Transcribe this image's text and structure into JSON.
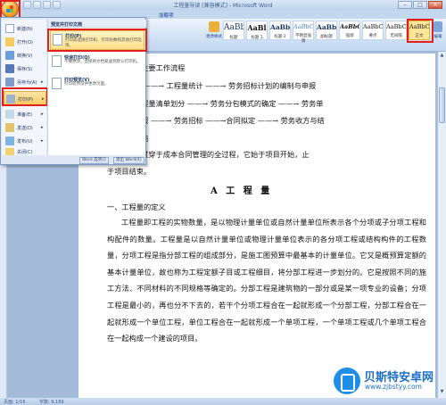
{
  "window": {
    "title": "工程量导读 [兼容模式] - Microsoft Word",
    "ribbon_context": "加载项"
  },
  "ribbon": {
    "styles": [
      {
        "sample": "AaBbCcDd",
        "name": "标题"
      },
      {
        "sample": "AaBl",
        "name": "标题 1"
      },
      {
        "sample": "AaBb",
        "name": "标题 2"
      },
      {
        "sample": "AaBbCcDd",
        "name": "不明显强调"
      },
      {
        "sample": "AaBbC",
        "name": "副标题"
      },
      {
        "sample": "AaBbCcD",
        "name": "强调"
      },
      {
        "sample": "AaBbCcDd",
        "name": "要点"
      },
      {
        "sample": "AaBbCcDd",
        "name": "无间隔"
      },
      {
        "sample": "AaBbCcDd",
        "name": "正文"
      }
    ],
    "change_styles_label": "更改样式",
    "edit_label": "编辑"
  },
  "office_menu": {
    "items": [
      {
        "label": "新建(N)",
        "has_arrow": false
      },
      {
        "label": "打开(O)",
        "has_arrow": false
      },
      {
        "label": "转换(V)",
        "has_arrow": false
      },
      {
        "label": "保存(S)",
        "has_arrow": false
      },
      {
        "label": "另存为(A)",
        "has_arrow": true
      },
      {
        "label": "打印(P)",
        "has_arrow": true
      },
      {
        "label": "准备(E)",
        "has_arrow": true
      },
      {
        "label": "发送(D)",
        "has_arrow": true
      },
      {
        "label": "发布(U)",
        "has_arrow": true
      },
      {
        "label": "关闭(C)",
        "has_arrow": false
      }
    ],
    "submenu_header": "预览并打印文档",
    "submenu": [
      {
        "title": "打印(P)",
        "desc": "打印前选择打印机、打印份数和其他打印选项。"
      },
      {
        "title": "快速打印(Q)",
        "desc": "不做更改，直接将文档发送到默认打印机。"
      },
      {
        "title": "打印预览(V)",
        "desc": "打印前预览并更改页面。"
      }
    ],
    "word_options": "Word 选项(I)",
    "exit_word": "退出 Word(X)"
  },
  "document": {
    "lines_top": [
      "程主要工作流程",
      "程  ——→  工程量统计  ——→  劳务招标计划的编制与申报",
      "工程量清单划分  ——→  劳务分包模式的确定  ——→  劳务单",
      "申报  ——→  劳务招标  ——→合同拟定 ——→  劳务收方与结",
      "总结",
      "程贯穿于成本合同管理的全过程，它始于项目开始，止",
      "于项目结束。"
    ],
    "heading": "A 工 程 量",
    "section": "一、工程量的定义",
    "paragraph": "工程量即工程的实物数量，是以物理计量单位或自然计量单位所表示各个分项或子分项工程和构配件的数量。工程量是以自然计量单位或物理计量单位表示的各分项工程或结构构件的工程数量，分项工程是指分部工程的组成部分，是施工图预算中最基本的计量单位。它又是概预算定额的基本计量单位，故也称为工程定额子目或工程细目，将分部工程进一步划分的。它是按照不同的施工方法、不同材料的不同规格等确定的。分部工程是建筑物的一部分或是某一项专业的设备；分项工程是最小的，再也分不下去的，若干个分项工程合在一起就形成一个分部工程，分部工程合在一起就形成一个单位工程，单位工程合在一起就形成一个单项工程，一个单项工程或几个单项工程合在一起构成一个建设的项目。"
  },
  "statusbar": {
    "page": "页面: 1/16",
    "words": "字数: 9,189"
  },
  "watermark": {
    "name": "贝斯特安卓网",
    "url": "www.zjbstyy.com"
  },
  "colors": {
    "highlight_frame": "#e0201b",
    "menu_active": "#f7c760",
    "watermark_blue": "#1f6fc6"
  }
}
